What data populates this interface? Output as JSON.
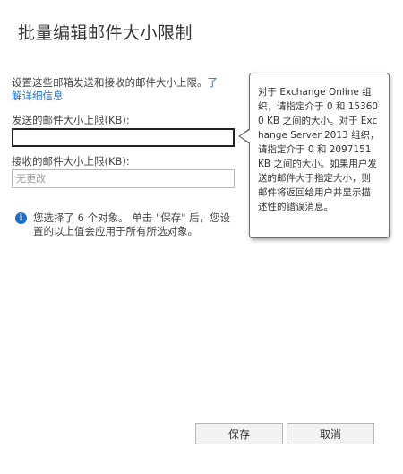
{
  "dialog": {
    "title": "批量编辑邮件大小限制"
  },
  "description": {
    "text": "设置这些邮箱发送和接收的邮件大小上限。",
    "link_text_part1": "了",
    "link_text_part2": "解详细信息"
  },
  "send_limit": {
    "label": "发送的邮件大小上限(KB):",
    "value": ""
  },
  "receive_limit": {
    "label": "接收的邮件大小上限(KB):",
    "placeholder": "无更改",
    "value": ""
  },
  "callout": {
    "text": "对于 Exchange Online 组织，请指定介于 0 和 153600 KB 之间的大小。对于 Exchange Server 2013 组织，请指定介于 0 和 2097151 KB 之间的大小。如果用户发送的邮件大于指定大小，则邮件将返回给用户并显示描述性的错误消息。"
  },
  "info": {
    "icon": "info-icon",
    "icon_glyph": "i",
    "text": "您选择了 6 个对象。 单击 \"保存\" 后，您设置的以上值会应用于所有所选对象。"
  },
  "buttons": {
    "save_label": "保存",
    "cancel_label": "取消"
  },
  "colors": {
    "link": "#1a6fc4",
    "info_icon": "#1f6fc5",
    "focused_border": "#222222"
  }
}
